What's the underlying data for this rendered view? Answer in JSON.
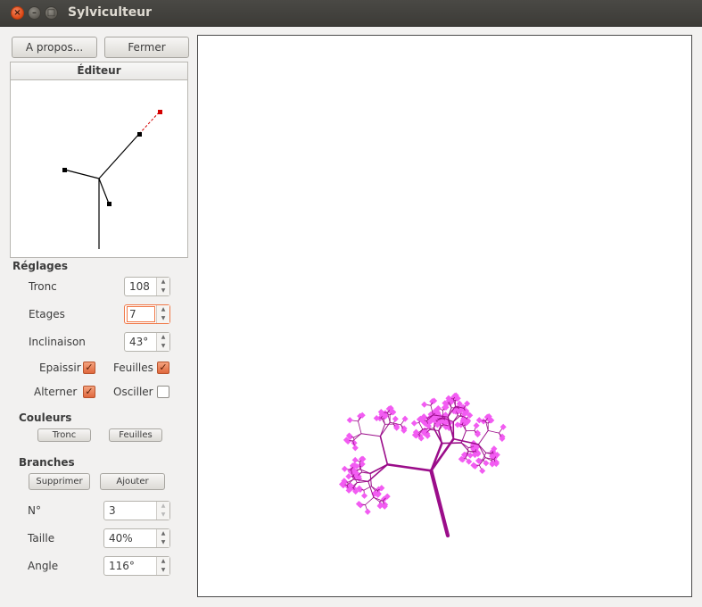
{
  "window": {
    "title": "Sylviculteur"
  },
  "toolbar": {
    "about_label": "A propos...",
    "close_label": "Fermer"
  },
  "editor": {
    "title": "Éditeur"
  },
  "settings": {
    "title": "Réglages",
    "trunk_label": "Tronc",
    "trunk_value": "108",
    "levels_label": "Etages",
    "levels_value": "7",
    "tilt_label": "Inclinaison",
    "tilt_value": "43°",
    "thicken_label": "Epaissir",
    "thicken_checked": true,
    "leaves_label": "Feuilles",
    "leaves_checked": true,
    "alternate_label": "Alterner",
    "alternate_checked": true,
    "oscillate_label": "Osciller",
    "oscillate_checked": false
  },
  "colors": {
    "title": "Couleurs",
    "trunk_button": "Tronc",
    "leaves_button": "Feuilles"
  },
  "branches": {
    "title": "Branches",
    "delete_button": "Supprimer",
    "add_button": "Ajouter",
    "number_label": "N°",
    "number_value": "3",
    "size_label": "Taille",
    "size_value": "40%",
    "angle_label": "Angle",
    "angle_value": "116°"
  },
  "palette": {
    "accent": "#f07746",
    "leaf": "#f25cf2",
    "branch": "#9b0d8a",
    "editor_handle": "#000000",
    "editor_target": "#d40000"
  }
}
